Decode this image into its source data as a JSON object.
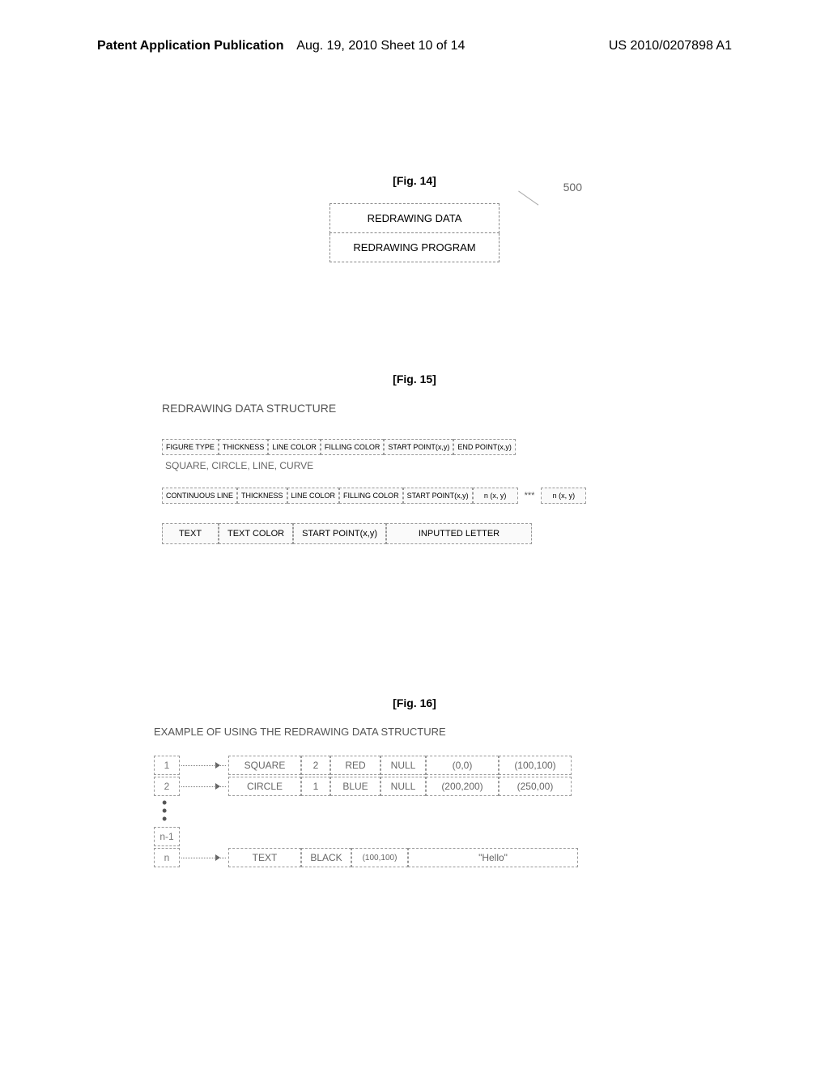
{
  "header": {
    "left": "Patent Application Publication",
    "center": "Aug. 19, 2010  Sheet 10 of 14",
    "right": "US 2010/0207898 A1"
  },
  "fig14": {
    "label": "[Fig. 14]",
    "callout_number": "500",
    "box1": "REDRAWING DATA",
    "box2": "REDRAWING PROGRAM"
  },
  "fig15": {
    "label": "[Fig. 15]",
    "title": "REDRAWING DATA STRUCTURE",
    "row1": {
      "c1": "FIGURE TYPE",
      "c2": "THICKNESS",
      "c3": "LINE COLOR",
      "c4": "FILLING COLOR",
      "c5": "START POINT(x,y)",
      "c6": "END POINT(x,y)"
    },
    "row1_sub": "SQUARE, CIRCLE, LINE, CURVE",
    "row2": {
      "c1": "CONTINUOUS LINE",
      "c2": "THICKNESS",
      "c3": "LINE COLOR",
      "c4": "FILLING COLOR",
      "c5": "START POINT(x,y)",
      "c6": "n (x, y)",
      "dots": "***",
      "c7": "n (x, y)"
    },
    "row3": {
      "c1": "TEXT",
      "c2": "TEXT COLOR",
      "c3": "START POINT(x,y)",
      "c4": "INPUTTED LETTER"
    }
  },
  "fig16": {
    "label": "[Fig. 16]",
    "title": "EXAMPLE OF USING THE REDRAWING DATA STRUCTURE",
    "rows": [
      {
        "idx": "1",
        "type": "SQUARE",
        "th": "2",
        "lc": "RED",
        "fc": "NULL",
        "sp": "(0,0)",
        "ep": "(100,100)"
      },
      {
        "idx": "2",
        "type": "CIRCLE",
        "th": "1",
        "lc": "BLUE",
        "fc": "NULL",
        "sp": "(200,200)",
        "ep": "(250,00)"
      }
    ],
    "idx_nm1": "n-1",
    "row_n": {
      "idx": "n",
      "type": "TEXT",
      "lc": "BLACK",
      "sp": "(100,100)",
      "letter": "\"Hello\""
    }
  }
}
